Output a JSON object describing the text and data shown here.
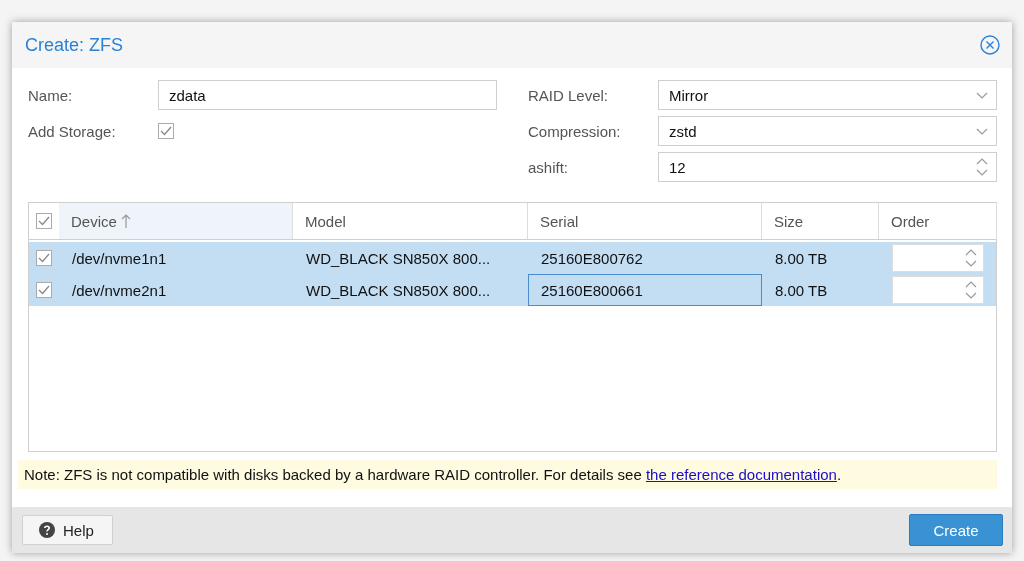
{
  "window": {
    "title": "Create: ZFS"
  },
  "form": {
    "left": [
      {
        "kind": "text",
        "label": "Name:",
        "value": "zdata"
      },
      {
        "kind": "checkbox",
        "label": "Add Storage:",
        "checked": true
      }
    ],
    "right": [
      {
        "kind": "select",
        "label": "RAID Level:",
        "value": "Mirror"
      },
      {
        "kind": "select",
        "label": "Compression:",
        "value": "zstd"
      },
      {
        "kind": "spinner",
        "label": "ashift:",
        "value": "12"
      }
    ]
  },
  "table": {
    "all_checked": true,
    "columns": [
      {
        "label": "Device",
        "sorted": true
      },
      {
        "label": "Model",
        "sorted": false
      },
      {
        "label": "Serial",
        "sorted": false
      },
      {
        "label": "Size",
        "sorted": false
      },
      {
        "label": "Order",
        "sorted": false
      }
    ],
    "rows": [
      {
        "checked": true,
        "selected": true,
        "cells": [
          {
            "text": "/dev/nvme1n1",
            "focused": false
          },
          {
            "text": "WD_BLACK SN850X 800...",
            "focused": false
          },
          {
            "text": "25160E800762",
            "focused": false
          },
          {
            "text": "8.00 TB",
            "focused": false
          }
        ]
      },
      {
        "checked": true,
        "selected": true,
        "cells": [
          {
            "text": "/dev/nvme2n1",
            "focused": false
          },
          {
            "text": "WD_BLACK SN850X 800...",
            "focused": false
          },
          {
            "text": "25160E800661",
            "focused": true
          },
          {
            "text": "8.00 TB",
            "focused": false
          }
        ]
      }
    ]
  },
  "note": {
    "text": "Note: ZFS is not compatible with disks backed by a hardware RAID controller. For details see ",
    "link": "the reference documentation",
    "end": "."
  },
  "footer": {
    "help": "Help",
    "create": "Create"
  }
}
